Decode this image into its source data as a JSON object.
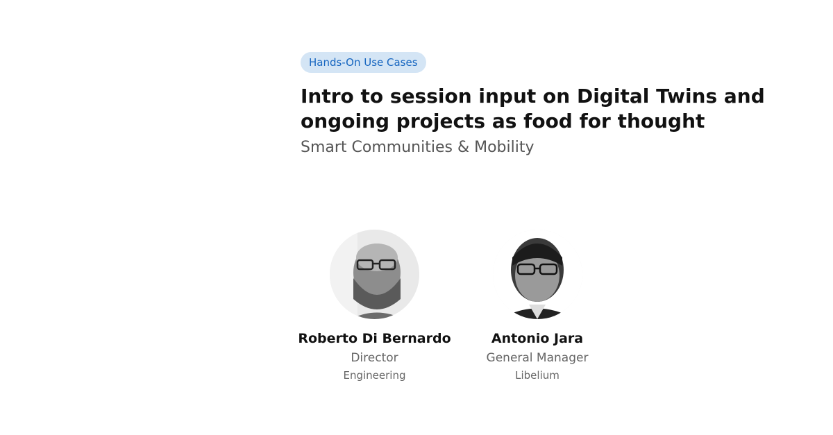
{
  "session": {
    "tag": "Hands-On Use Cases",
    "title": "Intro to session input on Digital Twins and ongoing projects as food for thought",
    "track": "Smart Communities & Mobility"
  },
  "speakers": [
    {
      "name": "Roberto Di Bernardo",
      "role": "Director",
      "organization": "Engineering",
      "photo_icon": "speaker-photo"
    },
    {
      "name": "Antonio Jara",
      "role": "General Manager",
      "organization": "Libelium",
      "photo_icon": "speaker-photo"
    }
  ],
  "colors": {
    "tag_background": "#d4e5f5",
    "tag_text": "#1565c0",
    "title_text": "#111111",
    "subtitle_text": "#555555"
  }
}
